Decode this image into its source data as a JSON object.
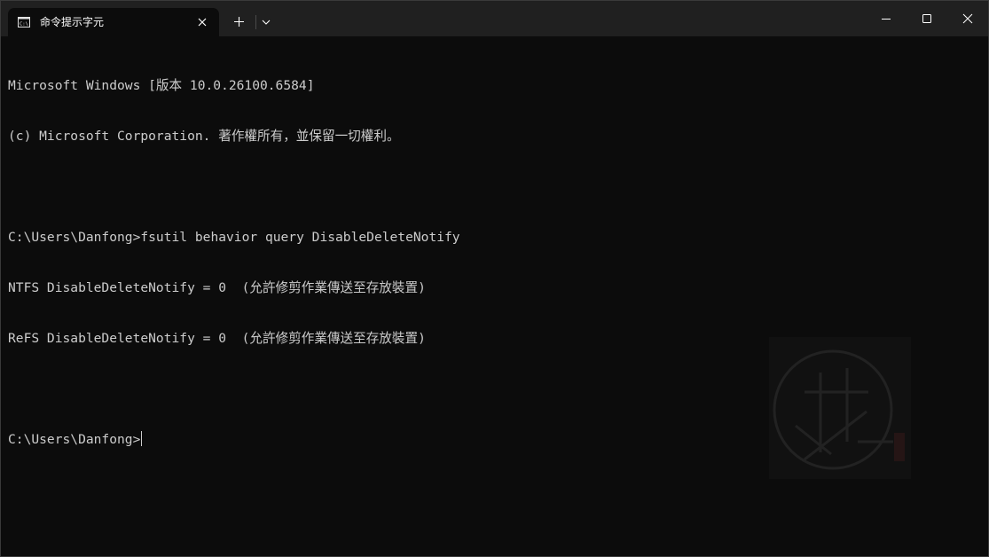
{
  "window": {
    "tab_title": "命令提示字元",
    "icons": {
      "tab": "cmd-terminal-icon",
      "close_tab": "close-icon",
      "new_tab": "plus-icon",
      "dropdown": "chevron-down-icon",
      "minimize": "minimize-icon",
      "maximize": "maximize-icon",
      "close": "close-icon"
    }
  },
  "terminal": {
    "lines": [
      "Microsoft Windows [版本 10.0.26100.6584]",
      "(c) Microsoft Corporation. 著作權所有，並保留一切權利。",
      "",
      "C:\\Users\\Danfong>fsutil behavior query DisableDeleteNotify",
      "NTFS DisableDeleteNotify = 0  (允許修剪作業傳送至存放裝置)",
      "ReFS DisableDeleteNotify = 0  (允許修剪作業傳送至存放裝置)",
      ""
    ],
    "prompt": "C:\\Users\\Danfong>"
  },
  "colors": {
    "background": "#0c0c0c",
    "titlebar": "#202020",
    "text": "#cccccc"
  }
}
